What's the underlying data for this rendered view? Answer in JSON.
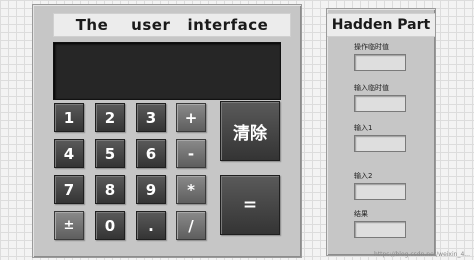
{
  "calculator": {
    "title": "The    user   interface",
    "display_value": "",
    "keys": {
      "k7": "7",
      "k8": "8",
      "k9": "9",
      "k4": "4",
      "k5": "5",
      "k6": "6",
      "k1": "1",
      "k2": "2",
      "k3": "3",
      "sign": "±",
      "k0": "0",
      "dot": ".",
      "plus": "+",
      "minus": "-",
      "multiply": "*",
      "divide": "/",
      "clear": "清除",
      "equals": "="
    }
  },
  "hidden_part": {
    "title": "Hadden Part",
    "fields": {
      "op_temp_label": "操作临时值",
      "op_temp_value": "",
      "input_temp_label": "输入临时值",
      "input_temp_value": "",
      "input1_label": "输入1",
      "input1_value": "",
      "input2_label": "输入2",
      "input2_value": "",
      "result_label": "结果",
      "result_value": ""
    }
  },
  "watermark": "https://blog.csdn.net/weixin_4..."
}
